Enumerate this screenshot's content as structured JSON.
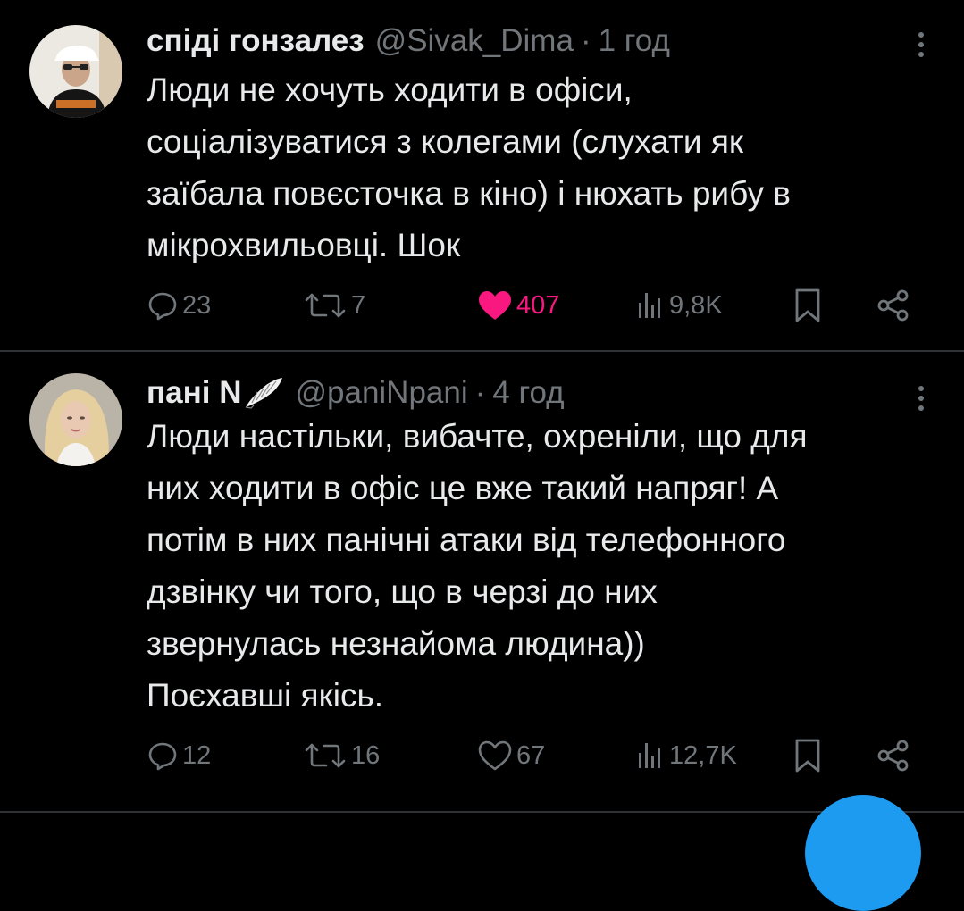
{
  "colors": {
    "background": "#000000",
    "text_primary": "#e7e9ea",
    "text_secondary": "#71767b",
    "like_active": "#f91880",
    "accent": "#1d9bf0",
    "divider": "#2f3336"
  },
  "tweets": [
    {
      "display_name": "спіді гонзалез",
      "handle": "@Sivak_Dima",
      "separator": "·",
      "time": "1 год",
      "text": "Люди не хочуть ходити в офіси,\nсоціалізуватися з колегами (слухати як\nзаїбала повєсточка в кіно) і нюхать рибу в\nмікрохвильовці. Шок",
      "counts": {
        "replies": "23",
        "retweets": "7",
        "likes": "407",
        "views": "9,8K"
      },
      "liked": true,
      "icons": {
        "avatar": "profile-photo",
        "more": "more-vertical-icon",
        "reply": "reply-icon",
        "retweet": "retweet-icon",
        "like": "heart-filled-icon",
        "views": "views-icon",
        "bookmark": "bookmark-icon",
        "share": "share-icon"
      }
    },
    {
      "display_name": "пані N",
      "handle": "@paniNpani",
      "separator": "·",
      "time": "4 год",
      "text": "Люди настільки, вибачте, охреніли, що для\nних ходити в офіс це вже такий напряг! А\nпотім в них панічні атаки від телефонного\nдзвінку чи того, що в черзі до них\nзвернулась незнайома людина))\nПоєхавші якісь.",
      "counts": {
        "replies": "12",
        "retweets": "16",
        "likes": "67",
        "views": "12,7K"
      },
      "liked": false,
      "icons": {
        "avatar": "profile-photo",
        "name_emoji": "wing-icon",
        "more": "more-vertical-icon",
        "reply": "reply-icon",
        "retweet": "retweet-icon",
        "like": "heart-outline-icon",
        "views": "views-icon",
        "bookmark": "bookmark-icon",
        "share": "share-icon"
      }
    }
  ]
}
